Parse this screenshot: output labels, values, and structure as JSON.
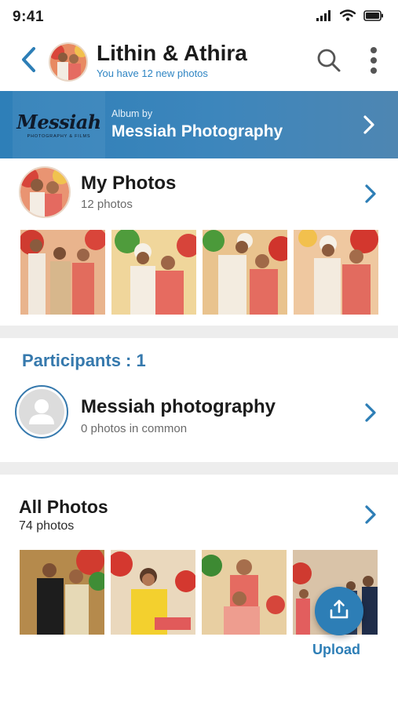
{
  "status_bar": {
    "time": "9:41"
  },
  "header": {
    "title": "Lithin & Athira",
    "subtitle": "You have 12 new photos"
  },
  "album_banner": {
    "logo_text": "Messiah",
    "logo_subtext": "PHOTOGRAPHY & FILMS",
    "label": "Album by",
    "photographer": "Messiah Photography"
  },
  "my_photos": {
    "title": "My Photos",
    "count": "12 photos"
  },
  "participants": {
    "heading": "Participants : 1",
    "items": [
      {
        "name": "Messiah photography",
        "common": "0 photos in common"
      }
    ]
  },
  "all_photos": {
    "title": "All Photos",
    "count": "74 photos"
  },
  "upload": {
    "label": "Upload"
  },
  "colors": {
    "accent": "#2d7eb6",
    "banner_start": "#2e7fb8",
    "banner_end": "#4e86b2",
    "link_blue": "#2f85c3",
    "participants_heading": "#3679ad",
    "divider": "#ededed"
  }
}
